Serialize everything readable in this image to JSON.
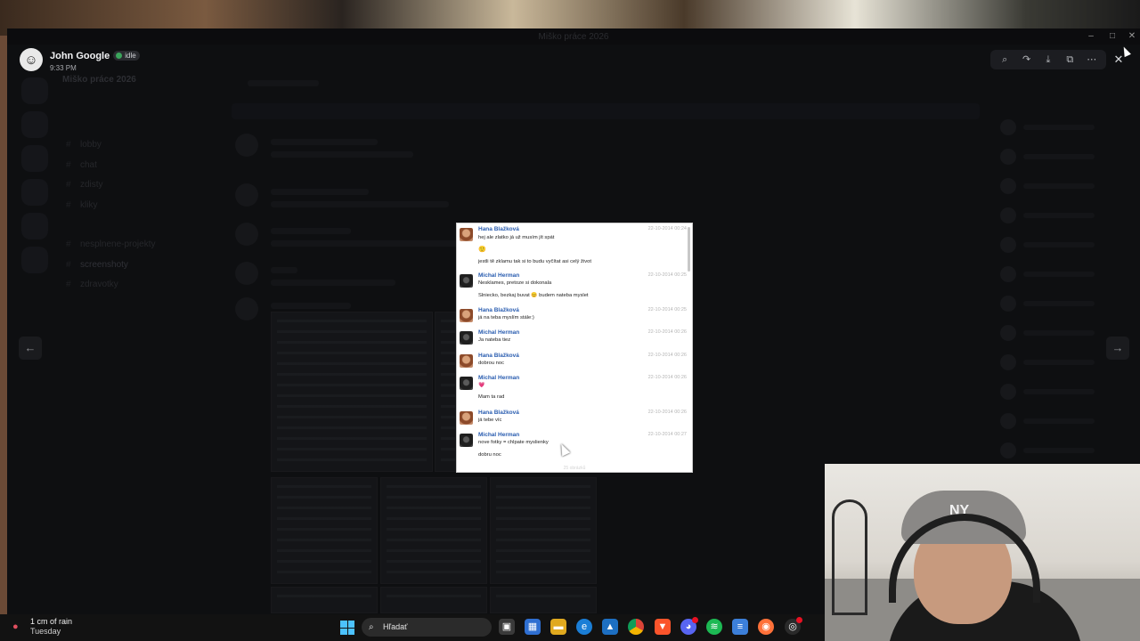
{
  "window": {
    "title": "Miško práce 2026",
    "banner": "",
    "controls": {
      "minimize": "–",
      "maximize": "□",
      "close": "✕"
    }
  },
  "discord_bg": {
    "server_name": "Miško práce 2026",
    "channels": [
      "lobby",
      "chat",
      "zdisty",
      "kliky",
      "nesplnene-projekty",
      "screenshoty",
      "zdravotky"
    ],
    "active_channel": "screenshoty"
  },
  "viewer": {
    "author": "John Google",
    "status": "idle",
    "time": "9:33 PM",
    "tools": {
      "zoom": "zoom-icon",
      "forward": "forward-icon",
      "download": "download-icon",
      "open": "open-external-icon",
      "more": "more-icon"
    },
    "close": "✕",
    "prev": "←",
    "next": "→"
  },
  "shot": {
    "messages": [
      {
        "sender": "Hana Blažková",
        "avatar": "hana",
        "time": "22-10-2014 00:24",
        "lines": [
          "hej ale zlatko já už musím jít spát",
          "",
          "jestli tě zklamu tak si to budu vyčítat asi celý život"
        ],
        "emoji": "🙂"
      },
      {
        "sender": "Michal Herman",
        "avatar": "michal",
        "time": "22-10-2014 00:25",
        "lines": [
          "Nesklames, pretoze si dokonala",
          "Slniecko, bezkaj buvat 😊 budem nateba myslet"
        ]
      },
      {
        "sender": "Hana Blažková",
        "avatar": "hana",
        "time": "22-10-2014 00:25",
        "lines": [
          "já na teba myslím stále:)"
        ]
      },
      {
        "sender": "Michal Herman",
        "avatar": "michal",
        "time": "22-10-2014 00:26",
        "lines": [
          "Ja nateba tiez"
        ]
      },
      {
        "sender": "Hana Blažková",
        "avatar": "hana",
        "time": "22-10-2014 00:26",
        "lines": [
          "dobrou noc"
        ]
      },
      {
        "sender": "Michal Herman",
        "avatar": "michal",
        "time": "22-10-2014 00:26",
        "lines": [
          "Mam ta rad"
        ],
        "emoji": "💗"
      },
      {
        "sender": "Hana Blažková",
        "avatar": "hana",
        "time": "22-10-2014 00:26",
        "lines": [
          "já tebe víc"
        ]
      },
      {
        "sender": "Michal Herman",
        "avatar": "michal",
        "time": "22-10-2014 00:27",
        "lines": [
          "nove fotky = chlpate myslienky",
          "dobru noc"
        ]
      }
    ],
    "footer": "25 obrázků"
  },
  "taskbar": {
    "weather_temp": "1 cm of rain",
    "weather_day": "Tuesday",
    "search_placeholder": "Hľadať",
    "apps": [
      "task-view-icon",
      "store-icon",
      "file-explorer-icon",
      "edge-icon",
      "photos-icon",
      "chrome-icon",
      "brave-icon",
      "discord-icon",
      "spotify-icon",
      "notepad-icon",
      "firefox-icon",
      "obs-icon"
    ]
  },
  "colors": {
    "accent_link": "#2a5db0",
    "idle": "#3ba55c",
    "start": "#4cc2ff"
  }
}
